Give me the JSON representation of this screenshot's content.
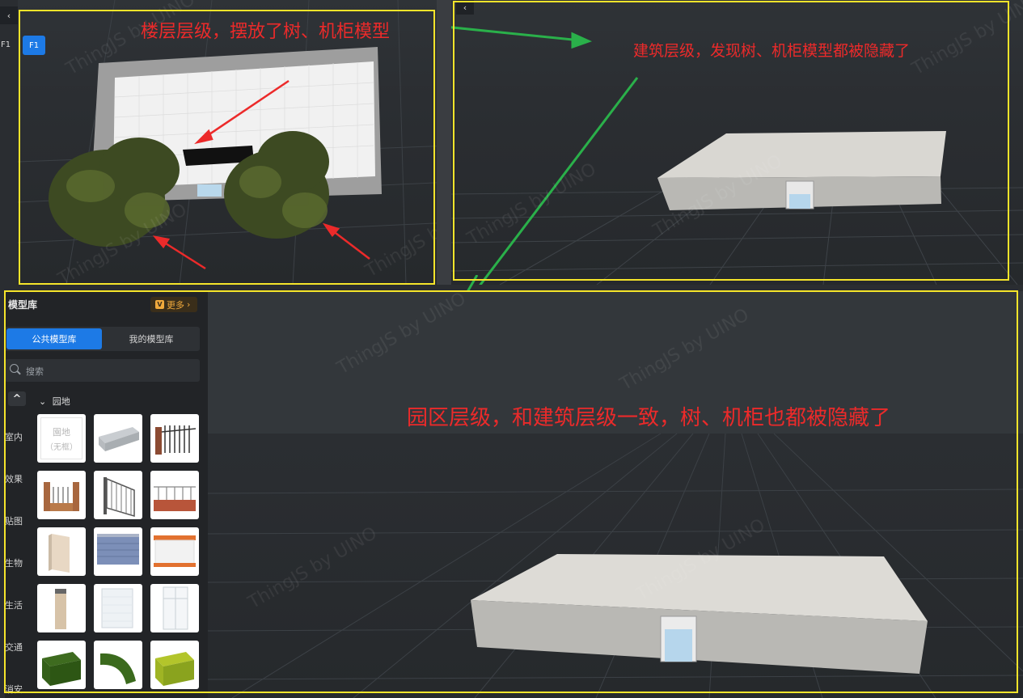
{
  "topleft": {
    "back_glyph": "‹",
    "floor_chip": "F1",
    "floor_button": "F1",
    "annotation": "楼层层级，摆放了树、机柜模型"
  },
  "topright": {
    "back_glyph": "‹",
    "annotation": "建筑层级，发现树、机柜模型都被隐藏了"
  },
  "bottom": {
    "annotation": "园区层级，和建筑层级一致，树、机柜也都被隐藏了"
  },
  "watermark": "ThingJS by UINO",
  "model_library": {
    "title": "模型库",
    "more_label": "更多",
    "more_chevron": "›",
    "tabs": [
      {
        "label": "公共模型库",
        "active": true
      },
      {
        "label": "我的模型库",
        "active": false
      }
    ],
    "search_placeholder": "搜索",
    "collapse_glyph": "^",
    "categories": [
      "室内",
      "效果",
      "贴图",
      "生物",
      "生活",
      "交通",
      "消安"
    ],
    "group_label": "园地",
    "group_chevron": "⌄",
    "first_thumb_lines": [
      "園地",
      "（无框）"
    ],
    "thumbnails": [
      "garden-placeholder",
      "stone-bench",
      "iron-gate",
      "brick-fence",
      "metal-gate",
      "rail-fence",
      "wall-panel",
      "blue-brick-wall",
      "orange-strip-wall",
      "post-panel",
      "glass-panel",
      "glass-door",
      "hedge-box",
      "hedge-curve",
      "hedge-yellow"
    ]
  },
  "colors": {
    "highlight": "#f5e42a",
    "annotation": "#ec2a2a",
    "arrow_green": "#2ab04a",
    "accent": "#1d7ae6"
  }
}
